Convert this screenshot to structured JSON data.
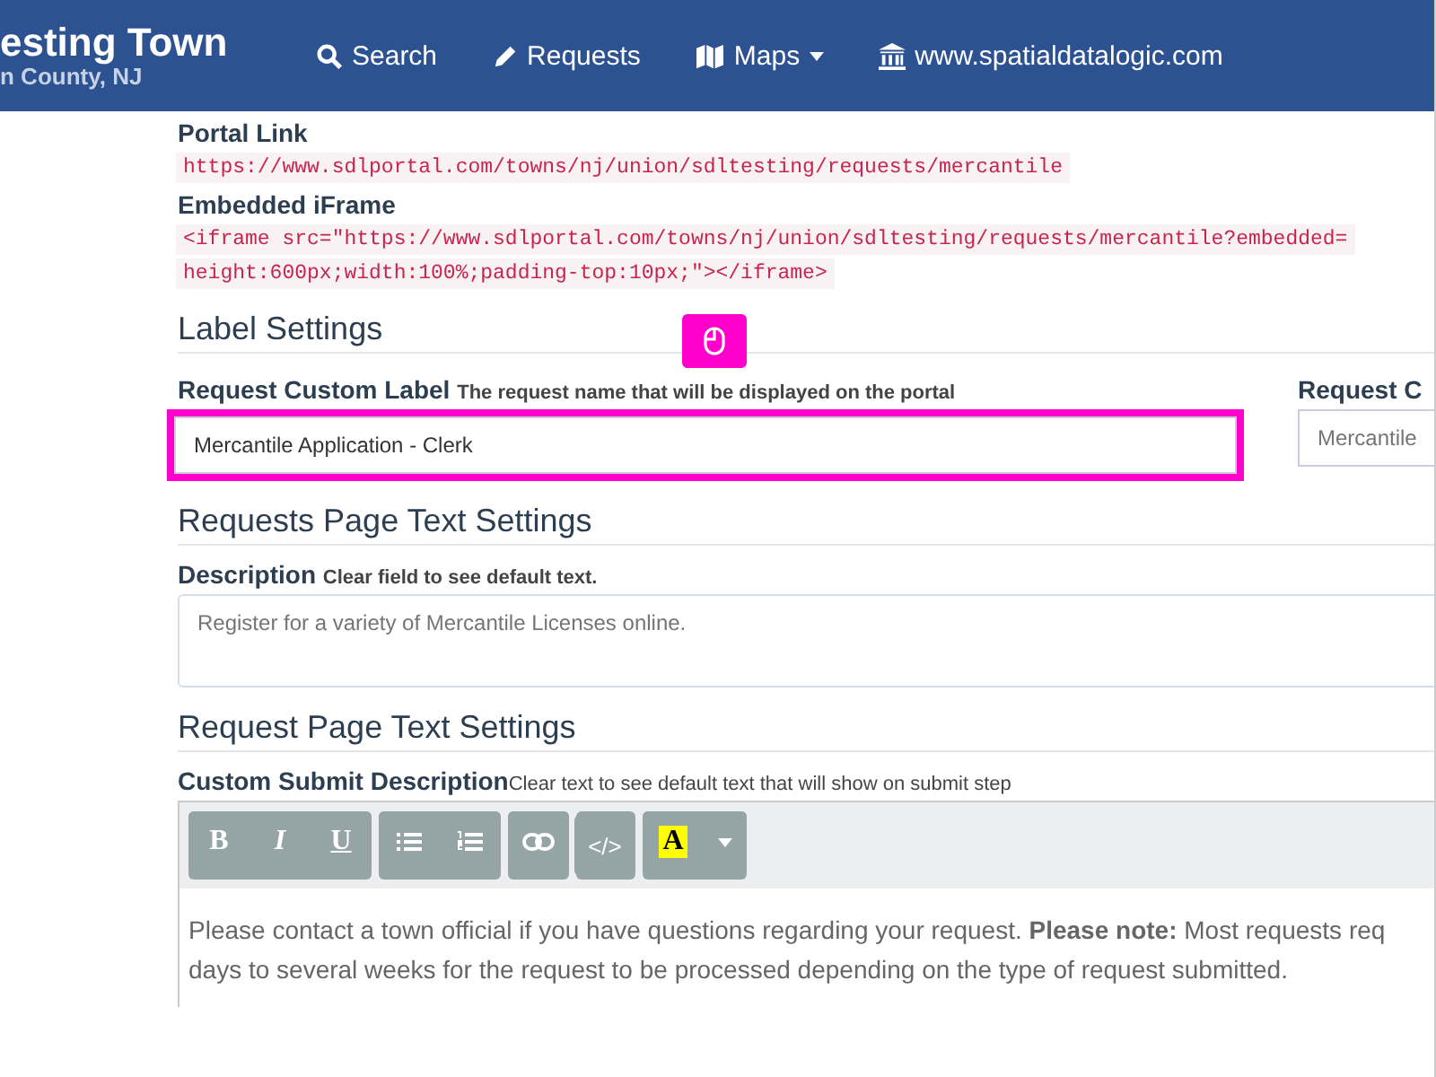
{
  "navbar": {
    "brand_title": "esting Town",
    "brand_subtitle": "n County, NJ",
    "items": [
      {
        "kind": "search",
        "label": "Search",
        "dropdown": false
      },
      {
        "kind": "pencil",
        "label": "Requests",
        "dropdown": false
      },
      {
        "kind": "map",
        "label": "Maps",
        "dropdown": true
      },
      {
        "kind": "bank",
        "label": "www.spatialdatalogic.com",
        "dropdown": false
      }
    ]
  },
  "links": {
    "portal_label": "Portal Link",
    "portal_url": "https://www.sdlportal.com/towns/nj/union/sdltesting/requests/mercantile",
    "iframe_label": "Embedded iFrame",
    "iframe_lines": [
      "<iframe src=\"https://www.sdlportal.com/towns/nj/union/sdltesting/requests/mercantile?embedded=",
      "height:600px;width:100%;padding-top:10px;\"></iframe>"
    ]
  },
  "label_settings": {
    "heading": "Label Settings",
    "label": "Request Custom Label",
    "hint": "The request name that will be displayed on the portal",
    "value": "Mercantile Application - Clerk",
    "highlighted": true,
    "second_label": "Request C",
    "second_placeholder": "Mercantile"
  },
  "requests_page": {
    "heading": "Requests Page Text Settings",
    "label": "Description",
    "hint": "Clear field to see default text.",
    "placeholder": "Register for a variety of Mercantile Licenses online."
  },
  "request_page": {
    "heading": "Request Page Text Settings",
    "label": "Custom Submit Description",
    "hint": "Clear text to see default text that will show on submit step",
    "toolbar": [
      [
        {
          "kind": "bold",
          "label": "B"
        },
        {
          "kind": "italic",
          "label": "I"
        },
        {
          "kind": "underline",
          "label": "U"
        }
      ],
      [
        {
          "kind": "bullets"
        },
        {
          "kind": "numbers"
        }
      ],
      [
        {
          "kind": "link"
        }
      ],
      [
        {
          "kind": "code",
          "label": "</>"
        }
      ],
      [
        {
          "kind": "highlight",
          "label": "A"
        },
        {
          "kind": "caret"
        }
      ]
    ],
    "text": "Please contact a town official if you have questions regarding your request. **Please note:** Most requests req",
    "text_2": "days to several weeks for the request to be processed depending on the type of request submitted."
  }
}
